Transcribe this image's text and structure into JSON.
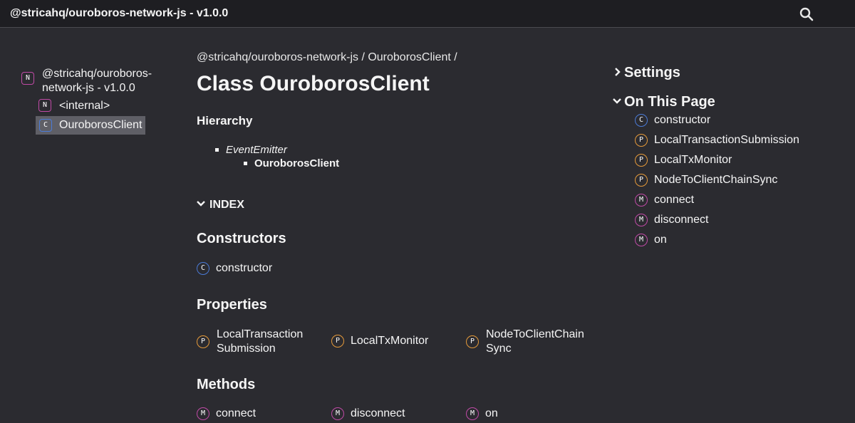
{
  "header": {
    "title": "@stricahq/ouroboros-network-js - v1.0.0",
    "search_icon": "search-icon"
  },
  "sidebar": {
    "root": {
      "kind": "N",
      "label": "@stricahq/ouroboros-network-js - v1.0.0"
    },
    "items": [
      {
        "kind": "N",
        "label": "<internal>"
      },
      {
        "kind": "C",
        "label": "OuroborosClient"
      }
    ]
  },
  "main": {
    "breadcrumb": "@stricahq/ouroboros-network-js / OuroborosClient /",
    "title": "Class OuroborosClient",
    "hierarchy": {
      "heading": "Hierarchy",
      "parent": "EventEmitter",
      "child": "OuroborosClient"
    },
    "index_label": "INDEX",
    "constructors": {
      "heading": "Constructors",
      "items": [
        {
          "kind": "C",
          "label": "constructor"
        }
      ]
    },
    "properties": {
      "heading": "Properties",
      "items": [
        {
          "kind": "P",
          "line1": "LocalTransaction",
          "line2": "Submission"
        },
        {
          "kind": "P",
          "label": "LocalTxMonitor"
        },
        {
          "kind": "P",
          "line1": "NodeToClientChain",
          "line2": "Sync"
        }
      ]
    },
    "methods": {
      "heading": "Methods",
      "items": [
        {
          "kind": "M",
          "label": "connect"
        },
        {
          "kind": "M",
          "label": "disconnect"
        },
        {
          "kind": "M",
          "label": "on"
        }
      ]
    }
  },
  "right": {
    "settings": "Settings",
    "on_this_page": "On This Page",
    "toc": [
      {
        "kind": "C",
        "label": "constructor"
      },
      {
        "kind": "P",
        "label": "LocalTransactionSubmission"
      },
      {
        "kind": "P",
        "label": "LocalTxMonitor"
      },
      {
        "kind": "P",
        "label": "NodeToClientChainSync"
      },
      {
        "kind": "M",
        "label": "connect"
      },
      {
        "kind": "M",
        "label": "disconnect"
      },
      {
        "kind": "M",
        "label": "on"
      }
    ]
  },
  "colors": {
    "background": "#2b2b30",
    "header": "#1e1e22",
    "namespace": "#c04aa6",
    "class": "#4b7bd8",
    "property": "#e59a3a",
    "method": "#c04aa6",
    "selected": "#5f5f66"
  }
}
